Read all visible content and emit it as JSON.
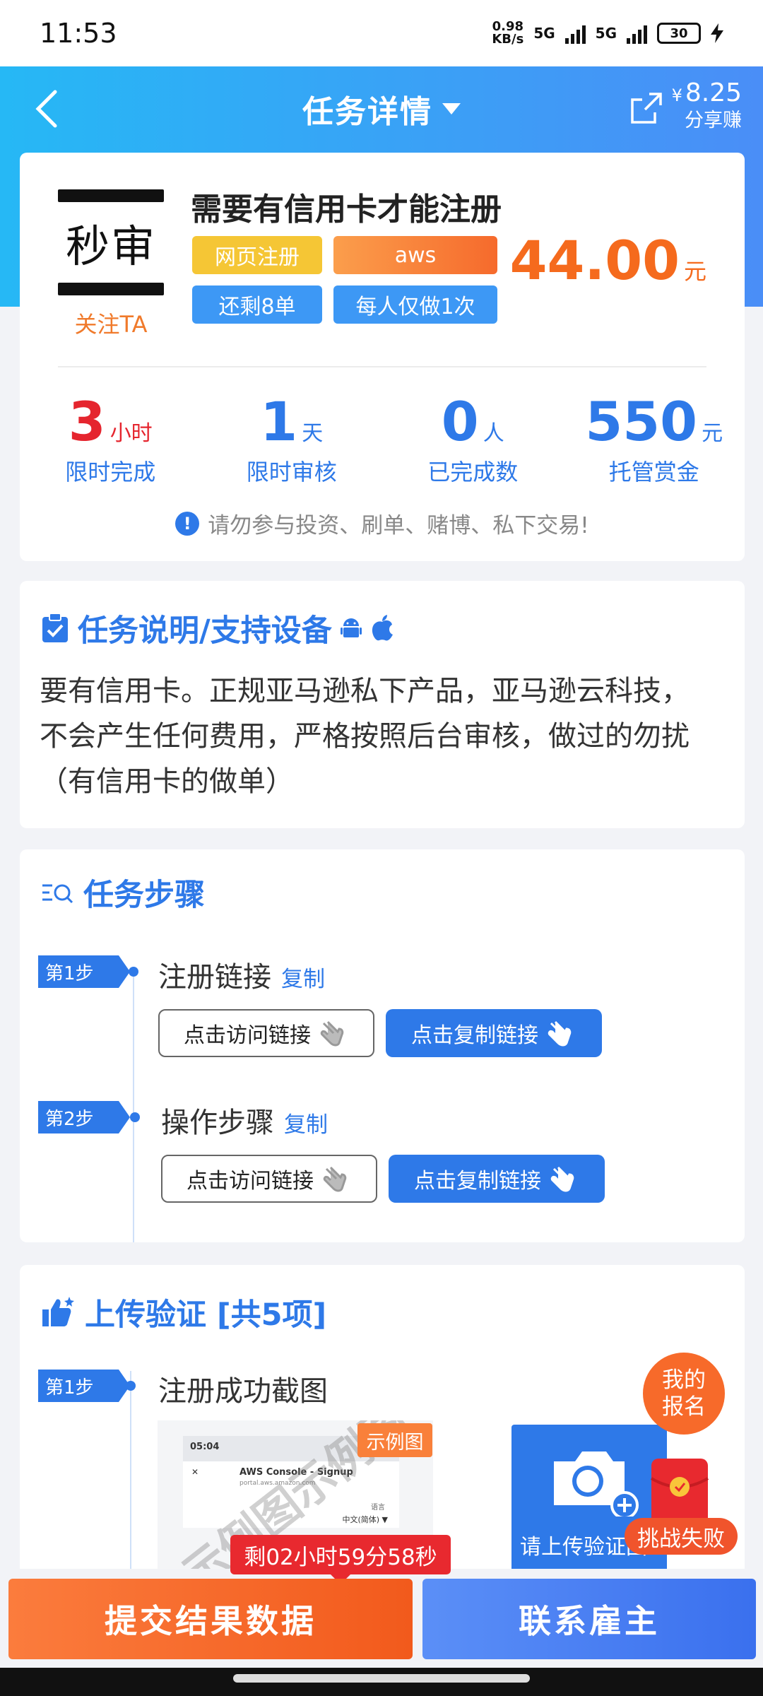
{
  "status_bar": {
    "time": "11:53",
    "net_speed": "0.98",
    "net_unit": "KB/s",
    "sim1": "5G",
    "sim2": "5G",
    "battery": "30"
  },
  "nav": {
    "title": "任务详情",
    "share_amount": "8.25",
    "share_currency": "¥",
    "share_label": "分享赚"
  },
  "task": {
    "logo_text": "秒审",
    "follow_label": "关注TA",
    "title": "需要有信用卡才能注册",
    "tags": [
      "网页注册",
      "aws",
      "还剩8单",
      "每人仅做1次"
    ],
    "price": "44.00",
    "price_unit": "元",
    "stats": [
      {
        "value": "3",
        "unit": "小时",
        "label": "限时完成"
      },
      {
        "value": "1",
        "unit": "天",
        "label": "限时审核"
      },
      {
        "value": "0",
        "unit": "人",
        "label": "已完成数"
      },
      {
        "value": "550",
        "unit": "元",
        "label": "托管赏金"
      }
    ],
    "warning": "请勿参与投资、刷单、赌博、私下交易!"
  },
  "description": {
    "heading": "任务说明/支持设备",
    "text": "要有信用卡。正规亚马逊私下产品，亚马逊云科技，不会产生任何费用，严格按照后台审核，做过的勿扰（有信用卡的做单）"
  },
  "steps": {
    "heading": "任务步骤",
    "items": [
      {
        "tag": "第1步",
        "name": "注册链接",
        "copy": "复制",
        "visit_btn": "点击访问链接",
        "copy_btn": "点击复制链接"
      },
      {
        "tag": "第2步",
        "name": "操作步骤",
        "copy": "复制",
        "visit_btn": "点击访问链接",
        "copy_btn": "点击复制链接"
      }
    ]
  },
  "upload": {
    "heading": "上传验证 [共5项]",
    "step_tag": "第1步",
    "step_name": "注册成功截图",
    "example_badge": "示例图",
    "watermark": "示例图示例图",
    "sample_time": "05:04",
    "sample_title": "AWS Console - Signup",
    "sample_url": "portal.aws.amazon.com",
    "sample_lang_label": "语言",
    "sample_lang": "中文(简体) ▼",
    "upload_label": "请上传验证图"
  },
  "float": {
    "my_signup": "我的报名",
    "challenge_failed": "挑战失败"
  },
  "footer": {
    "timer": "剩02小时59分58秒",
    "submit": "提交结果数据",
    "contact": "联系雇主"
  },
  "colors": {
    "primary": "#2e79e8",
    "accent": "#f56a1d",
    "danger": "#e8292f",
    "header_start": "#26b8f5",
    "header_end": "#4a8ef7"
  }
}
